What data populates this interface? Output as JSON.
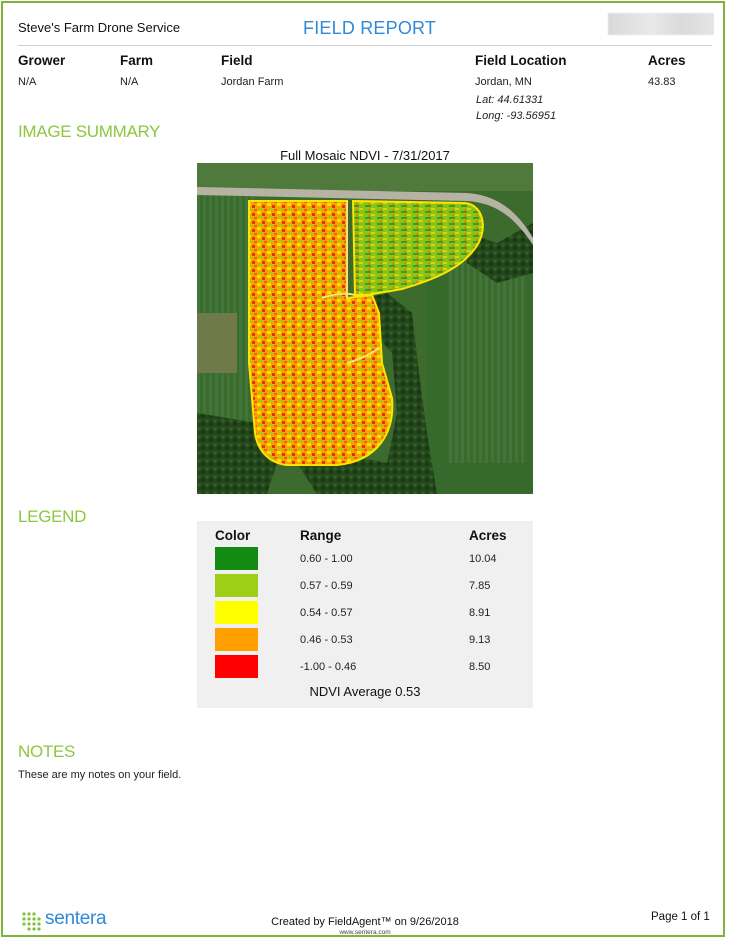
{
  "header": {
    "company": "Steve's Farm Drone Service",
    "title": "FIELD REPORT"
  },
  "info": {
    "grower": {
      "label": "Grower",
      "value": "N/A"
    },
    "farm": {
      "label": "Farm",
      "value": "N/A"
    },
    "field": {
      "label": "Field",
      "value": "Jordan Farm"
    },
    "location": {
      "label": "Field Location",
      "value": "Jordan, MN",
      "lat": "Lat: 44.61331",
      "long": "Long: -93.56951"
    },
    "acres": {
      "label": "Acres",
      "value": "43.83"
    }
  },
  "image_summary": {
    "heading": "IMAGE SUMMARY",
    "map_title": "Full Mosaic NDVI - 7/31/2017"
  },
  "legend": {
    "heading": "LEGEND",
    "col_color": "Color",
    "col_range": "Range",
    "col_acres": "Acres",
    "rows": [
      {
        "color": "#138a12",
        "range": "0.60 - 1.00",
        "acres": "10.04"
      },
      {
        "color": "#9ccf15",
        "range": "0.57 - 0.59",
        "acres": "7.85"
      },
      {
        "color": "#ffff00",
        "range": "0.54 - 0.57",
        "acres": "8.91"
      },
      {
        "color": "#ff9f00",
        "range": "0.46 - 0.53",
        "acres": "9.13"
      },
      {
        "color": "#ff0000",
        "range": "-1.00 - 0.46",
        "acres": "8.50"
      }
    ],
    "average": "NDVI Average 0.53"
  },
  "notes": {
    "heading": "NOTES",
    "text": "These are my notes on your field."
  },
  "footer": {
    "logo": "sentera",
    "created": "Created by FieldAgent™ on 9/26/2018",
    "url": "www.sentera.com",
    "page": "Page 1 of 1"
  },
  "colors": {
    "accent_green": "#8dc63f",
    "title_blue": "#2f8ad8",
    "border_green": "#7fb33c"
  }
}
